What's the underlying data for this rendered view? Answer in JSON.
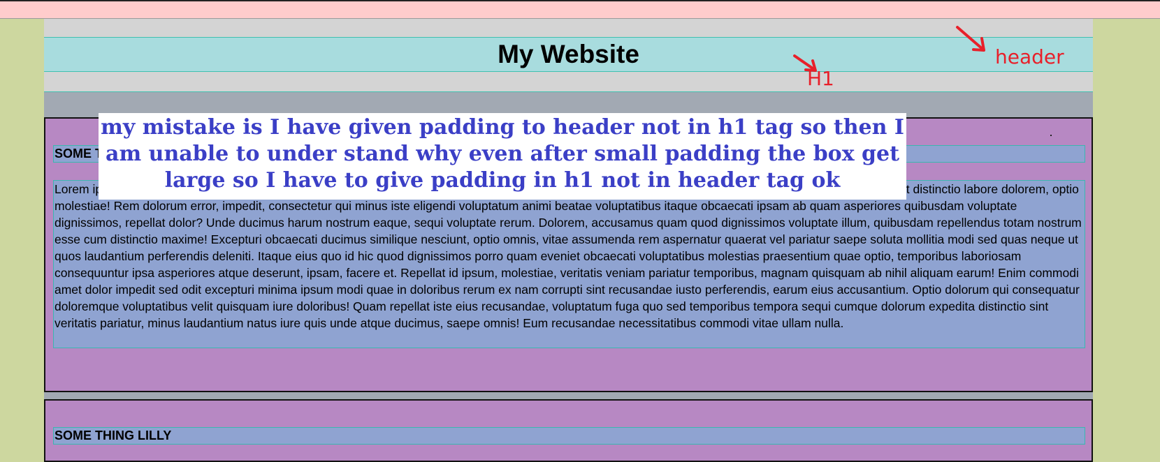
{
  "header": {
    "title": "My Website"
  },
  "annotations": {
    "h1_label": "H1",
    "header_label": "header",
    "color": "#e8202a"
  },
  "note": {
    "text": "my mistake is I have given padding to header not in h1 tag so then I am unable to under stand why even after small padding the box get large so I have to give padding in h1 not in header tag ok"
  },
  "sections": [
    {
      "heading": "SOME THING LILLY",
      "paragraph": "Lorem ipsum dolor sit amet consectetur adipisicing elit. Quas, voluptate? Nostrum similique quia cumque illo, veniam ducimus sed aliquid laborum in enim sint distinctio labore dolorem, optio molestiae! Rem dolorum error, impedit, consectetur qui minus iste eligendi voluptatum animi beatae voluptatibus itaque obcaecati ipsam ab quam asperiores quibusdam voluptate dignissimos, repellat dolor? Unde ducimus harum nostrum eaque, sequi voluptate rerum. Dolorem, accusamus quam quod dignissimos voluptate illum, quibusdam repellendus totam nostrum esse cum distinctio maxime! Excepturi obcaecati ducimus similique nesciunt, optio omnis, vitae assumenda rem aspernatur quaerat vel pariatur saepe soluta mollitia modi sed quas neque ut quos laudantium perferendis deleniti. Itaque eius quo id hic quod dignissimos porro quam eveniet obcaecati voluptatibus molestias praesentium quae optio, temporibus laboriosam consequuntur ipsa asperiores atque deserunt, ipsam, facere et. Repellat id ipsum, molestiae, veritatis veniam pariatur temporibus, magnam quisquam ab nihil aliquam earum! Enim commodi amet dolor impedit sed odit excepturi minima ipsum modi quae in doloribus rerum ex nam corrupti sint recusandae iusto perferendis, earum eius accusantium. Optio dolorum qui consequatur doloremque voluptatibus velit quisquam iure doloribus! Quam repellat iste eius recusandae, voluptatum fuga quo sed temporibus tempora sequi cumque dolorum expedita distinctio sint veritatis pariatur, minus laudantium natus iure quis unde atque ducimus, saepe omnis! Eum recusandae necessitatibus commodi vitae ullam nulla."
    },
    {
      "heading": "SOME THING LILLY"
    }
  ]
}
